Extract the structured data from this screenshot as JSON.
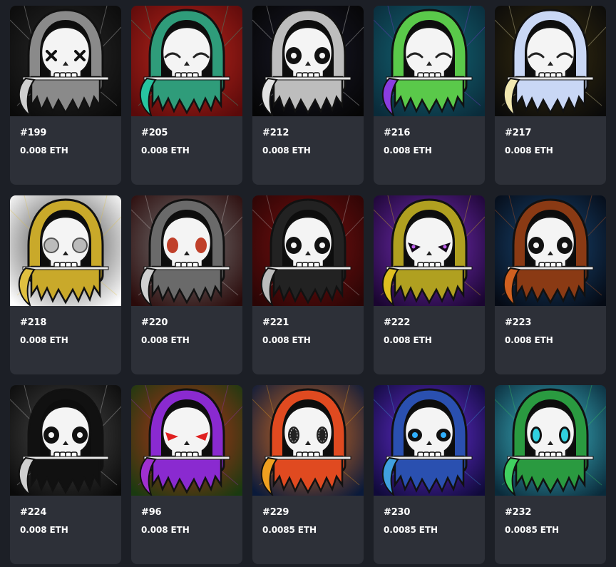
{
  "nfts": [
    {
      "id": "#199",
      "price": "0.008 ETH",
      "bg": [
        "#0a0a0a",
        "#2a2a2a"
      ],
      "accent": "#cfcfcf",
      "hood": "#8a8a8a",
      "eyes": "x"
    },
    {
      "id": "#205",
      "price": "0.008 ETH",
      "bg": [
        "#5a0a0a",
        "#c0281e"
      ],
      "accent": "#27c4a0",
      "hood": "#2f9c7a",
      "eyes": "closed"
    },
    {
      "id": "#212",
      "price": "0.008 ETH",
      "bg": [
        "#050505",
        "#1a1a2a"
      ],
      "accent": "#e3e3e3",
      "hood": "#bdbdbd",
      "eyes": "round"
    },
    {
      "id": "#216",
      "price": "0.008 ETH",
      "bg": [
        "#0a2b3a",
        "#146b7a"
      ],
      "accent": "#8a3de0",
      "hood": "#5ac94a",
      "eyes": "closed"
    },
    {
      "id": "#217",
      "price": "0.008 ETH",
      "bg": [
        "#0a0a0a",
        "#3a3010"
      ],
      "accent": "#f2e8b0",
      "hood": "#c9d7f5",
      "eyes": "closed"
    },
    {
      "id": "#218",
      "price": "0.008 ETH",
      "bg": [
        "#ffffff",
        "#3a3a3a"
      ],
      "accent": "#e0c040",
      "hood": "#c9a92a",
      "eyes": "bubble"
    },
    {
      "id": "#220",
      "price": "0.008 ETH",
      "bg": [
        "#2a0a0a",
        "#7a7a7a"
      ],
      "accent": "#d0d0d0",
      "hood": "#6a6a6a",
      "eyes": "red"
    },
    {
      "id": "#221",
      "price": "0.008 ETH",
      "bg": [
        "#2a0505",
        "#7a1010"
      ],
      "accent": "#bdbdbd",
      "hood": "#222222",
      "eyes": "round"
    },
    {
      "id": "#222",
      "price": "0.008 ETH",
      "bg": [
        "#1a0530",
        "#7a30c0"
      ],
      "accent": "#e0c020",
      "hood": "#b0a020",
      "eyes": "purple"
    },
    {
      "id": "#223",
      "price": "0.008 ETH",
      "bg": [
        "#050a14",
        "#1a4a7a"
      ],
      "accent": "#d06020",
      "hood": "#8a3a14",
      "eyes": "round"
    },
    {
      "id": "#224",
      "price": "0.008 ETH",
      "bg": [
        "#0a0a0a",
        "#4a4a4a"
      ],
      "accent": "#cfcfcf",
      "hood": "#111111",
      "eyes": "round"
    },
    {
      "id": "#96",
      "price": "0.008 ETH",
      "bg": [
        "#1a3a10",
        "#c0301a"
      ],
      "accent": "#a030d0",
      "hood": "#8a2ad0",
      "eyes": "redangry"
    },
    {
      "id": "#229",
      "price": "0.0085 ETH",
      "bg": [
        "#0a1a3a",
        "#e07020"
      ],
      "accent": "#f0a020",
      "hood": "#e04a20",
      "eyes": "static"
    },
    {
      "id": "#230",
      "price": "0.0085 ETH",
      "bg": [
        "#100a3a",
        "#6a30e0"
      ],
      "accent": "#40a0e0",
      "hood": "#2a50b0",
      "eyes": "blue"
    },
    {
      "id": "#232",
      "price": "0.0085 ETH",
      "bg": [
        "#0a2a3a",
        "#40c0d0"
      ],
      "accent": "#40d060",
      "hood": "#2a9a40",
      "eyes": "cyan"
    }
  ]
}
